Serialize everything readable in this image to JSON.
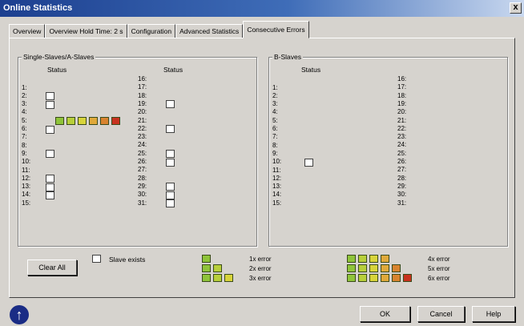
{
  "window": {
    "title": "Online Statistics",
    "close_label": "x"
  },
  "tabs": [
    {
      "label": "Overview",
      "active": false
    },
    {
      "label": "Overview  Hold Time: 2 s",
      "active": false
    },
    {
      "label": "Configuration",
      "active": false
    },
    {
      "label": "Advanced Statistics",
      "active": false
    },
    {
      "label": "Consecutive Errors",
      "active": true
    }
  ],
  "groups": {
    "single": {
      "title": "Single-Slaves/A-Slaves",
      "status_header_1": "Status",
      "status_header_2": "Status",
      "col1": [
        {
          "n": "1:",
          "status": "none"
        },
        {
          "n": "2:",
          "status": "exists"
        },
        {
          "n": "3:",
          "status": "exists"
        },
        {
          "n": "4:",
          "status": "none"
        },
        {
          "n": "5:",
          "status": "error6"
        },
        {
          "n": "6:",
          "status": "exists"
        },
        {
          "n": "7:",
          "status": "none"
        },
        {
          "n": "8:",
          "status": "none"
        },
        {
          "n": "9:",
          "status": "exists"
        },
        {
          "n": "10:",
          "status": "none"
        },
        {
          "n": "11:",
          "status": "none"
        },
        {
          "n": "12:",
          "status": "exists"
        },
        {
          "n": "13:",
          "status": "exists"
        },
        {
          "n": "14:",
          "status": "exists"
        },
        {
          "n": "15:",
          "status": "none"
        }
      ],
      "col2": [
        {
          "n": "16:",
          "status": "none"
        },
        {
          "n": "17:",
          "status": "none"
        },
        {
          "n": "18:",
          "status": "none"
        },
        {
          "n": "19:",
          "status": "exists"
        },
        {
          "n": "20:",
          "status": "none"
        },
        {
          "n": "21:",
          "status": "none"
        },
        {
          "n": "22:",
          "status": "exists"
        },
        {
          "n": "23:",
          "status": "none"
        },
        {
          "n": "24:",
          "status": "none"
        },
        {
          "n": "25:",
          "status": "exists"
        },
        {
          "n": "26:",
          "status": "exists"
        },
        {
          "n": "27:",
          "status": "none"
        },
        {
          "n": "28:",
          "status": "none"
        },
        {
          "n": "29:",
          "status": "exists"
        },
        {
          "n": "30:",
          "status": "exists"
        },
        {
          "n": "31:",
          "status": "exists"
        }
      ]
    },
    "b": {
      "title": "B-Slaves",
      "status_header": "Status",
      "col1": [
        {
          "n": "1:",
          "status": "none"
        },
        {
          "n": "2:",
          "status": "none"
        },
        {
          "n": "3:",
          "status": "none"
        },
        {
          "n": "4:",
          "status": "none"
        },
        {
          "n": "5:",
          "status": "none"
        },
        {
          "n": "6:",
          "status": "none"
        },
        {
          "n": "7:",
          "status": "none"
        },
        {
          "n": "8:",
          "status": "none"
        },
        {
          "n": "9:",
          "status": "none"
        },
        {
          "n": "10:",
          "status": "exists"
        },
        {
          "n": "11:",
          "status": "none"
        },
        {
          "n": "12:",
          "status": "none"
        },
        {
          "n": "13:",
          "status": "none"
        },
        {
          "n": "14:",
          "status": "none"
        },
        {
          "n": "15:",
          "status": "none"
        }
      ],
      "col2": [
        {
          "n": "16:"
        },
        {
          "n": "17:"
        },
        {
          "n": "18:"
        },
        {
          "n": "19:"
        },
        {
          "n": "20:"
        },
        {
          "n": "21:"
        },
        {
          "n": "22:"
        },
        {
          "n": "23:"
        },
        {
          "n": "24:"
        },
        {
          "n": "25:"
        },
        {
          "n": "26:"
        },
        {
          "n": "27:"
        },
        {
          "n": "28:"
        },
        {
          "n": "29:"
        },
        {
          "n": "30:"
        },
        {
          "n": "31:"
        }
      ]
    }
  },
  "error_colors": [
    "#8fc43a",
    "#b8cf3a",
    "#d8d43a",
    "#e0a93a",
    "#d9832f",
    "#c8321f"
  ],
  "legend": {
    "slave_exists": "Slave exists",
    "errors": [
      {
        "label": "1x error",
        "count": 1
      },
      {
        "label": "2x error",
        "count": 2
      },
      {
        "label": "3x error",
        "count": 3
      },
      {
        "label": "4x error",
        "count": 4
      },
      {
        "label": "5x error",
        "count": 5
      },
      {
        "label": "6x error",
        "count": 6
      }
    ]
  },
  "buttons": {
    "clear_all": "Clear All",
    "ok": "OK",
    "cancel": "Cancel",
    "help": "Help"
  },
  "icons": {
    "info": "info-icon",
    "close": "close-icon",
    "checkbox": "checkbox-icon"
  }
}
